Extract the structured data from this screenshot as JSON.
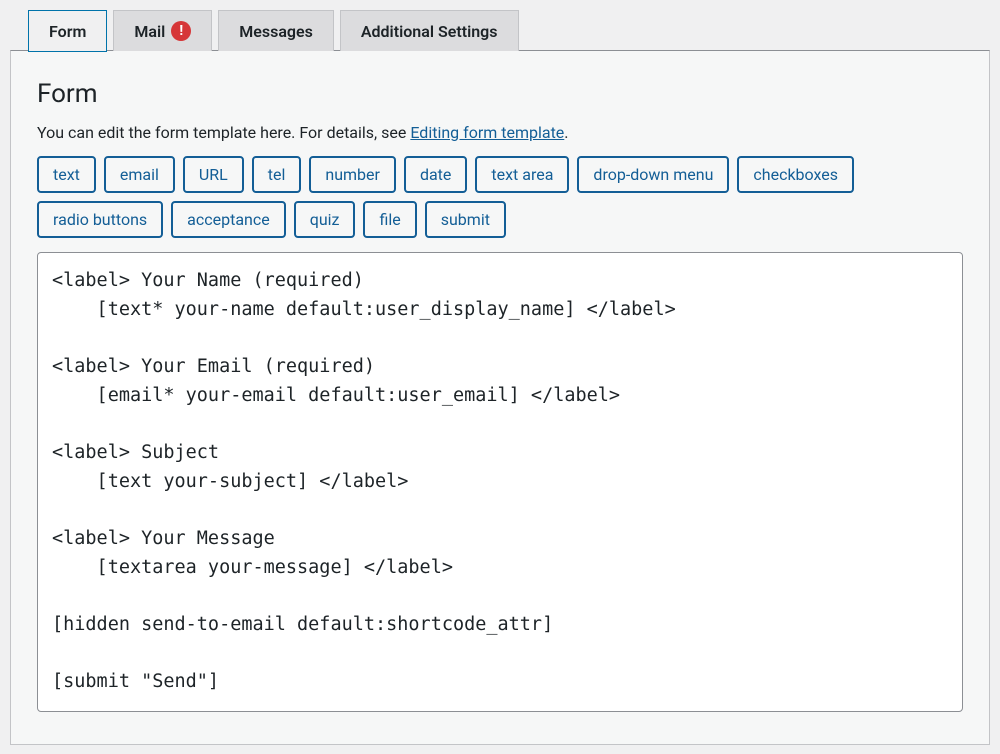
{
  "tabs": {
    "form": "Form",
    "mail": "Mail",
    "mail_alert": "!",
    "messages": "Messages",
    "additional": "Additional Settings"
  },
  "section": {
    "title": "Form",
    "desc_prefix": "You can edit the form template here. For details, see ",
    "desc_link": "Editing form template",
    "desc_suffix": "."
  },
  "tag_buttons": [
    "text",
    "email",
    "URL",
    "tel",
    "number",
    "date",
    "text area",
    "drop-down menu",
    "checkboxes",
    "radio buttons",
    "acceptance",
    "quiz",
    "file",
    "submit"
  ],
  "form_template": "<label> Your Name (required)\n    [text* your-name default:user_display_name] </label>\n\n<label> Your Email (required)\n    [email* your-email default:user_email] </label>\n\n<label> Subject\n    [text your-subject] </label>\n\n<label> Your Message\n    [textarea your-message] </label>\n\n[hidden send-to-email default:shortcode_attr]\n\n[submit \"Send\"]"
}
